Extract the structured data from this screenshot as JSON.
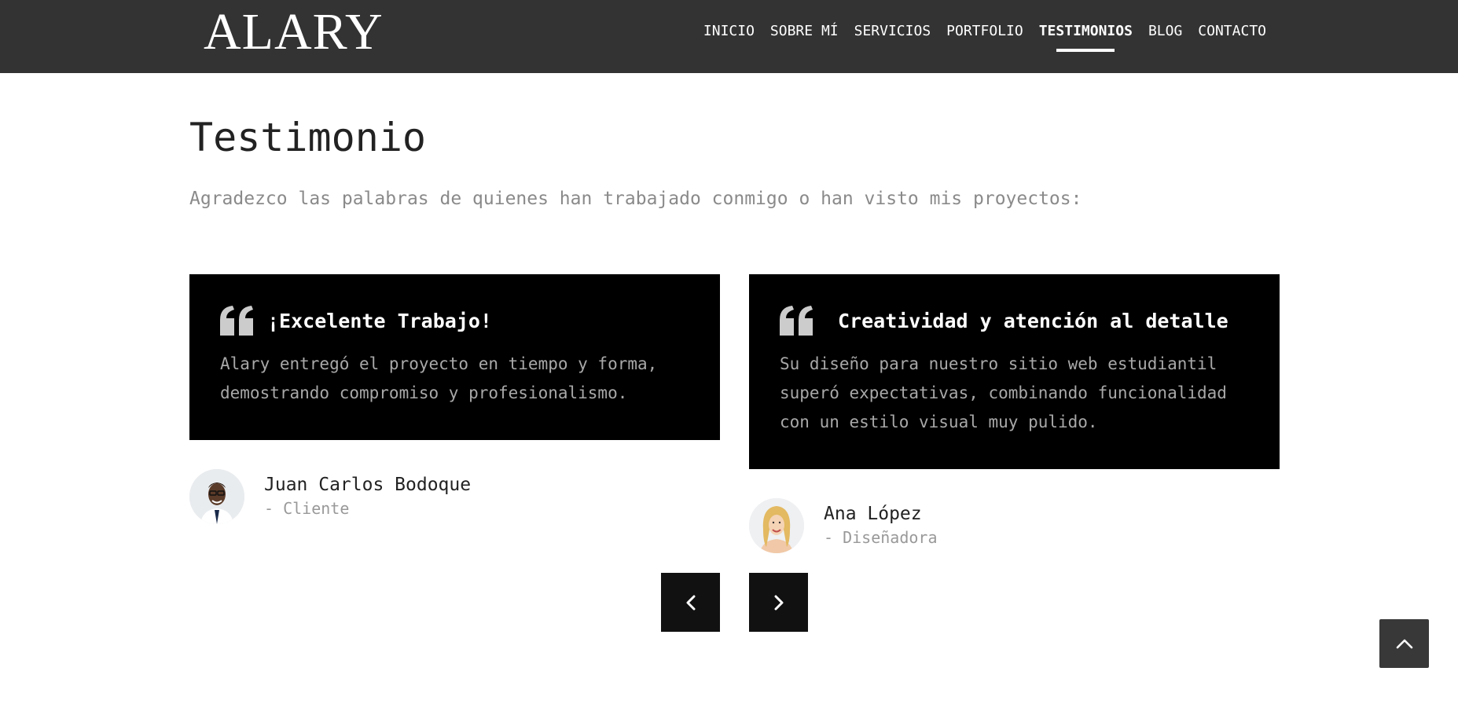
{
  "header": {
    "logo": "ALARY",
    "nav": [
      {
        "label": "INICIO",
        "active": false
      },
      {
        "label": "SOBRE MÍ",
        "active": false
      },
      {
        "label": "SERVICIOS",
        "active": false
      },
      {
        "label": "PORTFOLIO",
        "active": false
      },
      {
        "label": "TESTIMONIOS",
        "active": true
      },
      {
        "label": "BLOG",
        "active": false
      },
      {
        "label": "CONTACTO",
        "active": false
      }
    ]
  },
  "section": {
    "title": "Testimonio",
    "subtitle": "Agradezco las palabras de quienes han trabajado conmigo o han visto mis proyectos:"
  },
  "testimonials": [
    {
      "icon": "quote-icon",
      "title": "¡Excelente Trabajo!",
      "body": "Alary entregó el proyecto en tiempo y forma, demostrando compromiso y profesionalismo.",
      "author_name": "Juan Carlos Bodoque",
      "author_role": "- Cliente",
      "avatar_icon": "avatar-man"
    },
    {
      "icon": "quote-icon",
      "title": "Creatividad y atención al detalle",
      "body": "Su diseño para nuestro sitio web estudiantil superó expectativas, combinando funcionalidad con un estilo visual muy pulido.",
      "author_name": "Ana López",
      "author_role": "- Diseñadora",
      "avatar_icon": "avatar-woman"
    }
  ],
  "carousel": {
    "prev_icon": "chevron-left-icon",
    "next_icon": "chevron-right-icon"
  },
  "back_to_top": {
    "icon": "chevron-up-icon"
  },
  "colors": {
    "navbar_bg": "#333333",
    "card_bg": "#000000",
    "card_text": "#a8a8a8",
    "quote_icon": "#cccccc",
    "control_bg": "#111111"
  }
}
